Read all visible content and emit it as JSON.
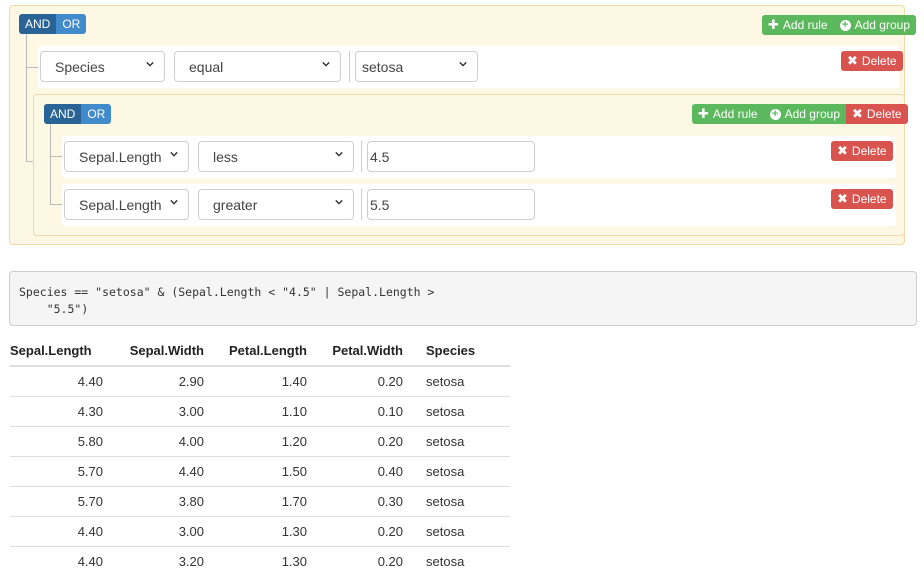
{
  "outer_group": {
    "conditions": [
      "AND",
      "OR"
    ],
    "active_condition": "AND",
    "actions": {
      "add_rule": "Add rule",
      "add_group": "Add group"
    },
    "rules": [
      {
        "field": "Species",
        "operator": "equal",
        "value": "setosa",
        "delete_label": "Delete"
      }
    ]
  },
  "inner_group": {
    "conditions": [
      "AND",
      "OR"
    ],
    "active_condition": "AND",
    "actions": {
      "add_rule": "Add rule",
      "add_group": "Add group",
      "delete": "Delete"
    },
    "rules": [
      {
        "field": "Sepal.Length",
        "operator": "less",
        "value": "4.5",
        "delete_label": "Delete"
      },
      {
        "field": "Sepal.Length",
        "operator": "greater",
        "value": "5.5",
        "delete_label": "Delete"
      }
    ]
  },
  "query_code": "Species == \"setosa\" & (Sepal.Length < \"4.5\" | Sepal.Length >\n    \"5.5\")",
  "table": {
    "headers": [
      "Sepal.Length",
      "Sepal.Width",
      "Petal.Length",
      "Petal.Width",
      "Species"
    ],
    "rows": [
      [
        "4.40",
        "2.90",
        "1.40",
        "0.20",
        "setosa"
      ],
      [
        "4.30",
        "3.00",
        "1.10",
        "0.10",
        "setosa"
      ],
      [
        "5.80",
        "4.00",
        "1.20",
        "0.20",
        "setosa"
      ],
      [
        "5.70",
        "4.40",
        "1.50",
        "0.40",
        "setosa"
      ],
      [
        "5.70",
        "3.80",
        "1.70",
        "0.30",
        "setosa"
      ],
      [
        "4.40",
        "3.00",
        "1.30",
        "0.20",
        "setosa"
      ],
      [
        "4.40",
        "3.20",
        "1.30",
        "0.20",
        "setosa"
      ]
    ]
  },
  "colors": {
    "primary": "#428bca",
    "primary_active": "#2a6496",
    "success": "#5cb85c",
    "danger": "#d9534f",
    "group_bg": "#fcf8e3"
  }
}
